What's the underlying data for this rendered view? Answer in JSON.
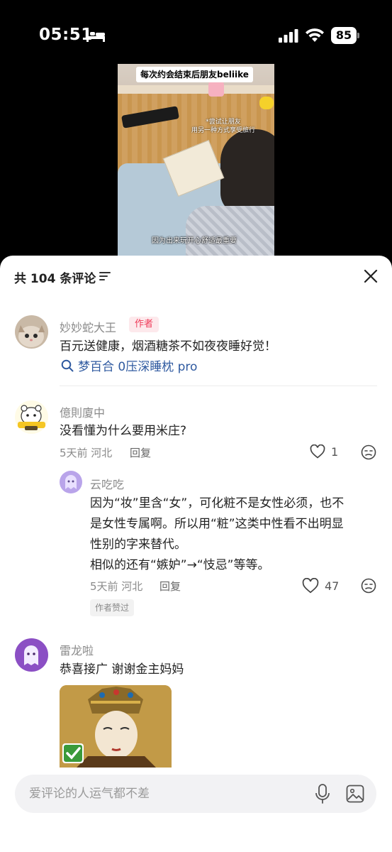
{
  "status_bar": {
    "time": "05:51",
    "battery": "85"
  },
  "video": {
    "caption_top": "每次约会结束后朋友beliike",
    "caption_mid_line1": "*尝试让朋友",
    "caption_mid_line2": "用另一种方式享受旅行",
    "caption_bottom": "因为出来玩开心舒适最重要"
  },
  "sheet": {
    "title": "共 104 条评论"
  },
  "comments": [
    {
      "username": "妙妙蛇大王",
      "tag": "作者",
      "text": "百元送健康，烟酒糖茶不如夜夜睡好觉！",
      "search_link": "梦百合 0压深睡枕 pro"
    },
    {
      "username": "億則廈中",
      "text": "没看懂为什么要用米庄?",
      "meta": "5天前 河北",
      "reply_label": "回复",
      "likes": "1",
      "reply": {
        "username": "云吃吃",
        "text_line1": "因为“妆”里含“女”，可化粧不是女性必须，也不",
        "text_line2": "是女性专属啊。所以用“粧”这类中性看不出明显",
        "text_line3": "性别的字来替代。",
        "text_line4": "相似的还有“嫉妒”→“忮忌”等等。",
        "meta": "5天前 河北",
        "reply_label": "回复",
        "likes": "47",
        "badge": "作者赞过"
      }
    },
    {
      "username": "雷龙啦",
      "text": "恭喜接广 谢谢金主妈妈"
    }
  ],
  "input": {
    "placeholder": "爱评论的人运气都不差"
  }
}
